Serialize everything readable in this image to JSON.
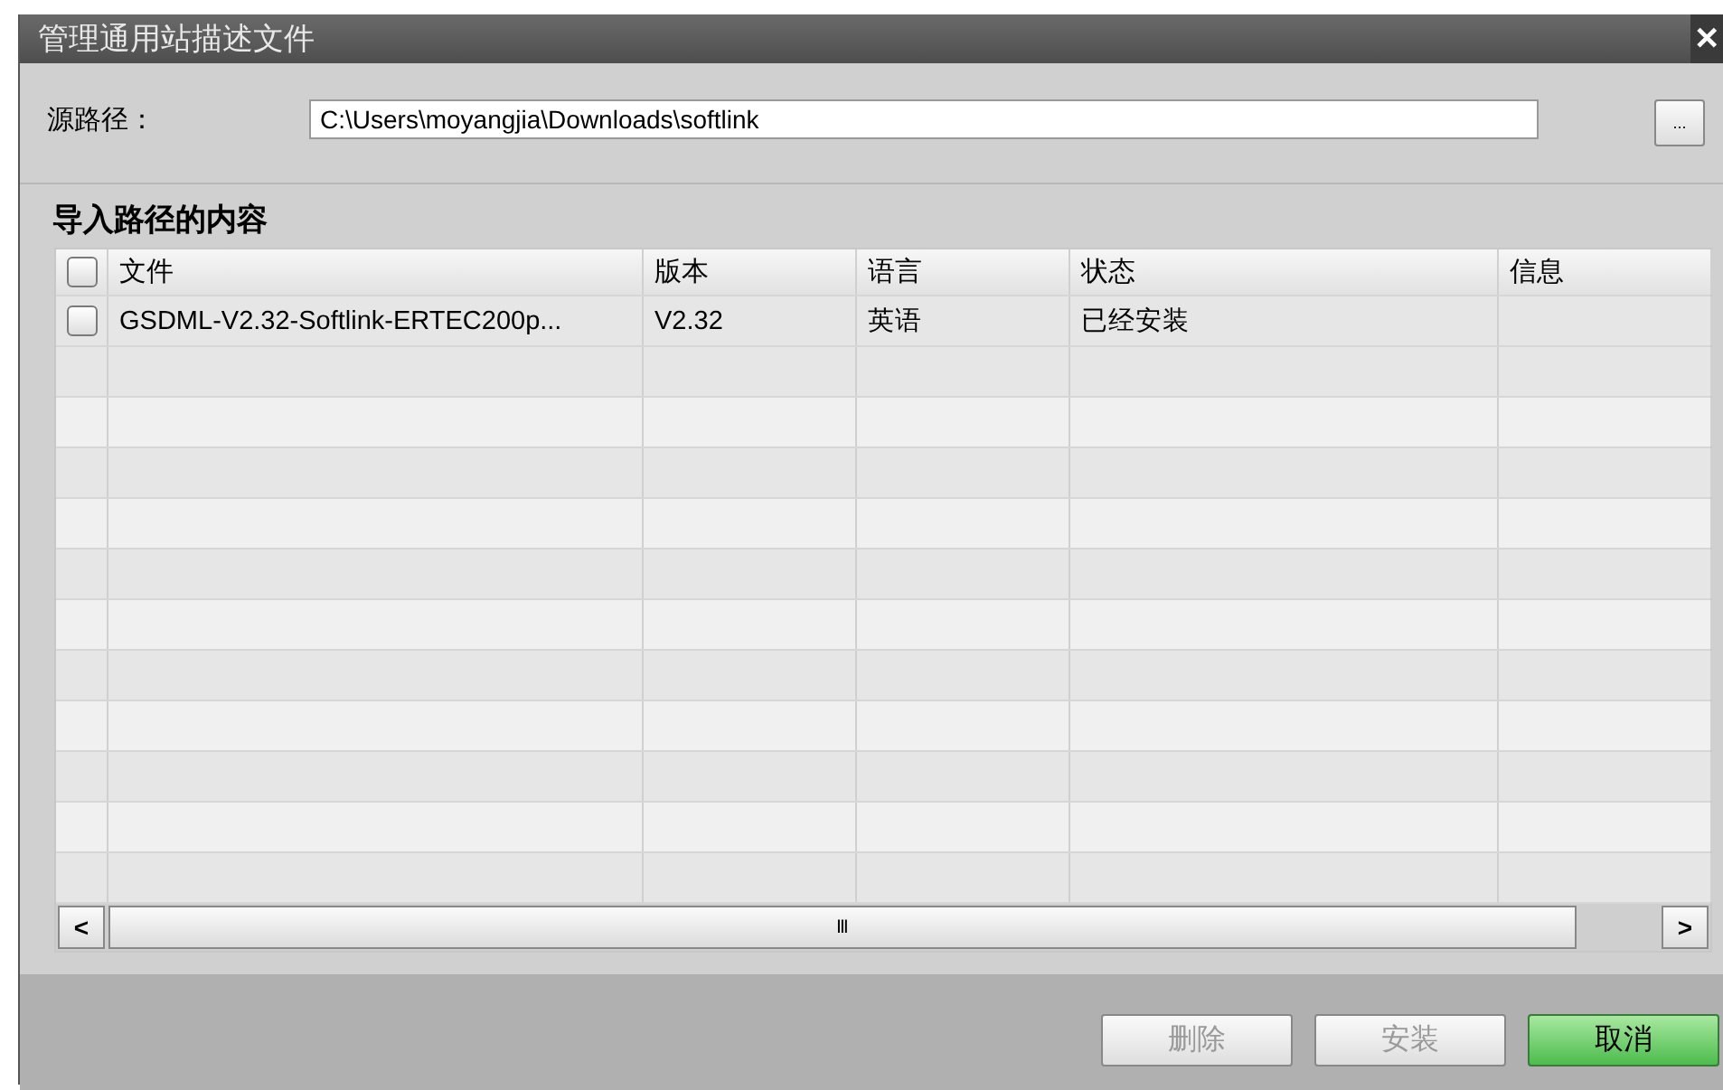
{
  "window": {
    "title": "管理通用站描述文件",
    "close": "✕"
  },
  "source_path": {
    "label": "源路径：",
    "value": "C:\\Users\\moyangjia\\Downloads\\softlink",
    "browse": "..."
  },
  "section_title": "导入路径的内容",
  "table": {
    "select_all_checked": false,
    "columns": [
      "文件",
      "版本",
      "语言",
      "状态",
      "信息"
    ],
    "rows": [
      {
        "checked": false,
        "cells": [
          "GSDML-V2.32-Softlink-ERTEC200p...",
          "V2.32",
          "英语",
          "已经安装",
          ""
        ]
      }
    ],
    "scroll_left": "<",
    "scroll_grip": "Ⅲ",
    "scroll_right": ">"
  },
  "buttons": [
    {
      "label": "删除",
      "disabled": true,
      "primary": false
    },
    {
      "label": "安装",
      "disabled": true,
      "primary": false
    },
    {
      "label": "取消",
      "disabled": false,
      "primary": true
    }
  ]
}
